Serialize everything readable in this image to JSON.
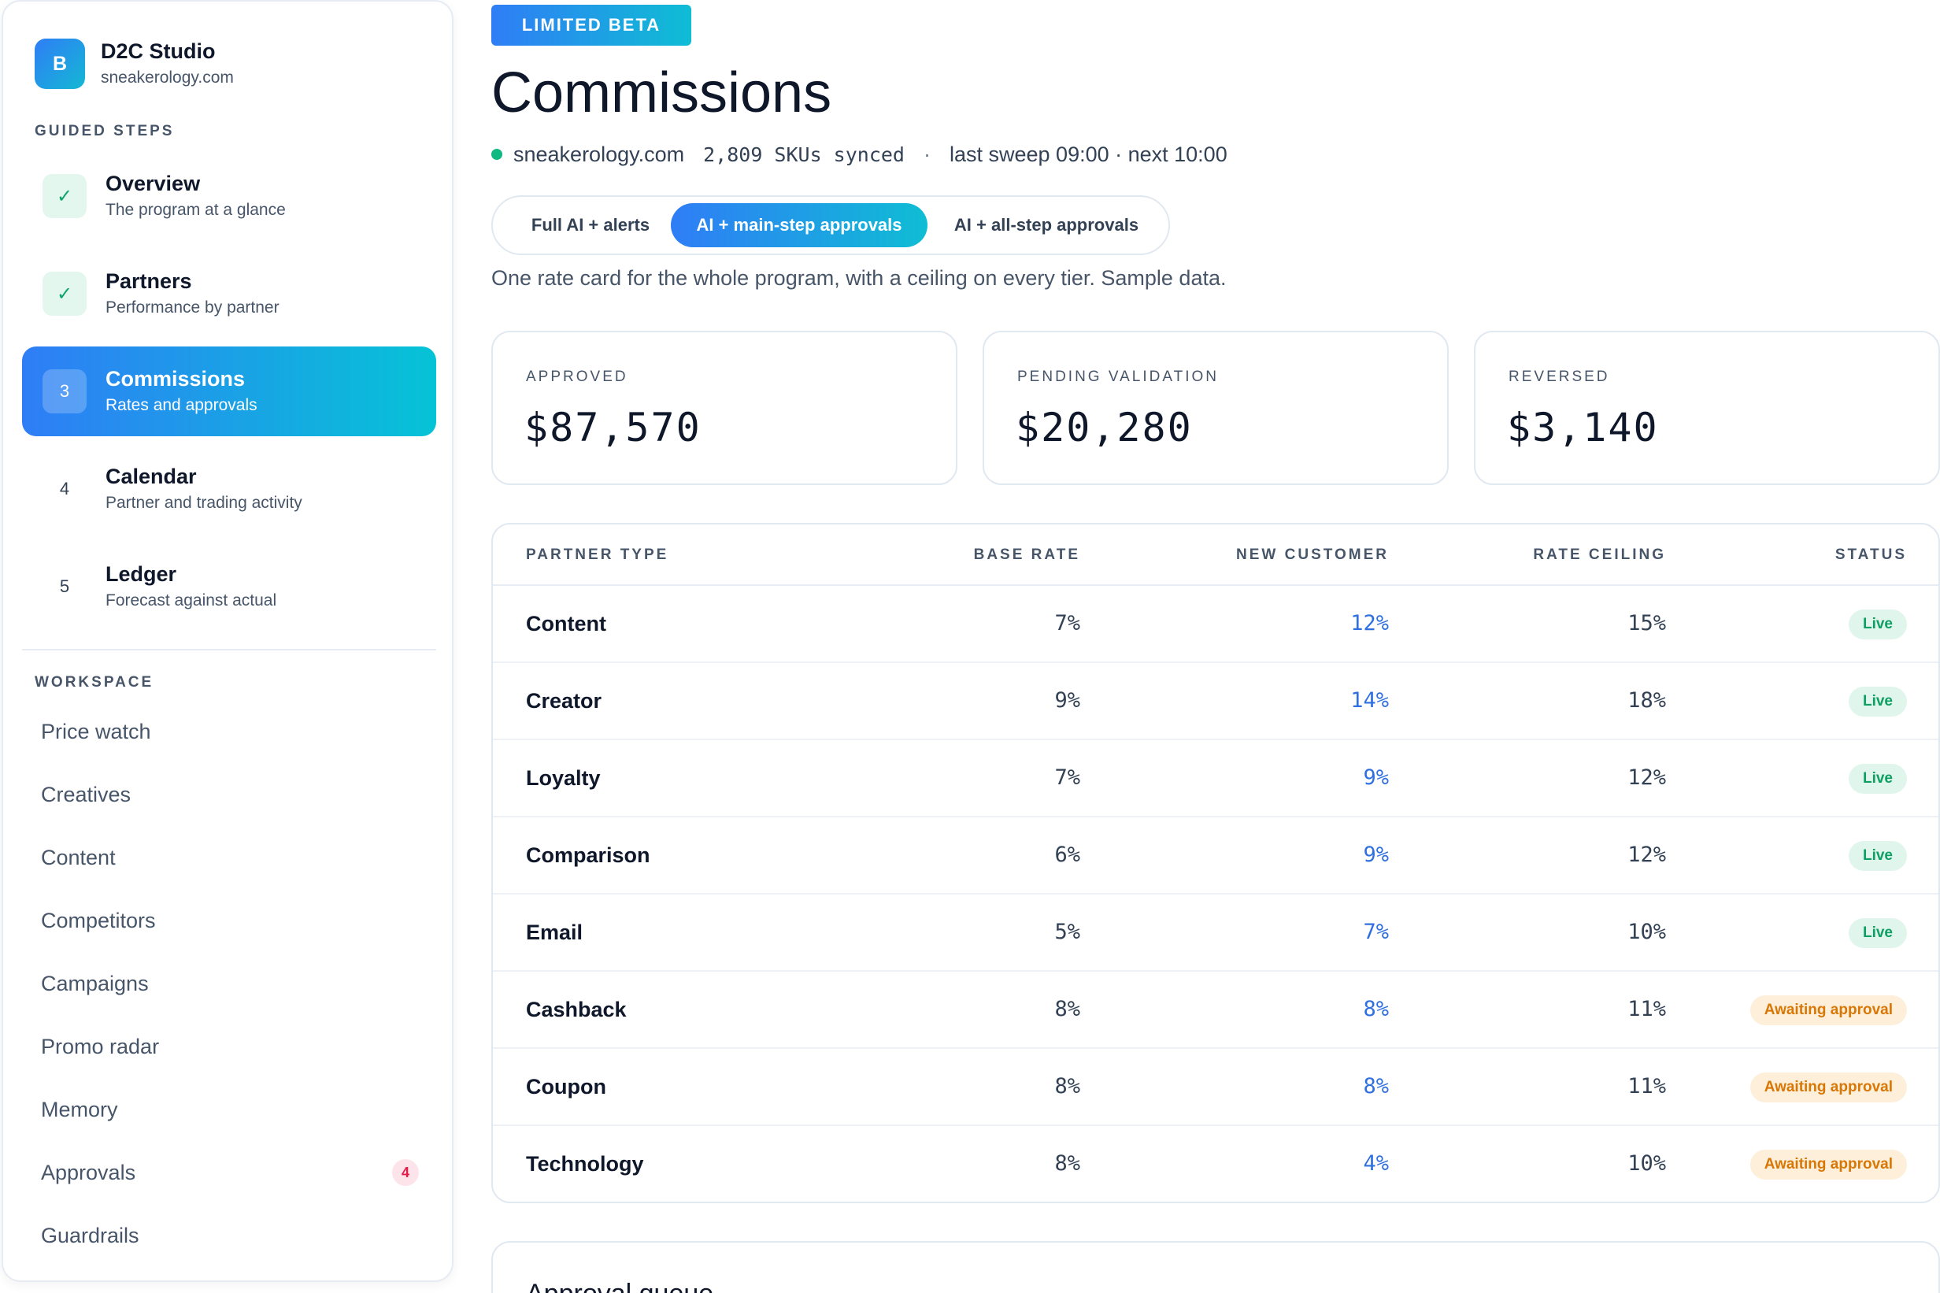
{
  "brand": {
    "logo": "B",
    "name": "D2C Studio",
    "domain": "sneakerology.com"
  },
  "sidebar": {
    "guided_label": "GUIDED STEPS",
    "steps": [
      {
        "marker": "✓",
        "title": "Overview",
        "subtitle": "The program at a glance",
        "state": "done"
      },
      {
        "marker": "✓",
        "title": "Partners",
        "subtitle": "Performance by partner",
        "state": "done"
      },
      {
        "marker": "3",
        "title": "Commissions",
        "subtitle": "Rates and approvals",
        "state": "active"
      },
      {
        "marker": "4",
        "title": "Calendar",
        "subtitle": "Partner and trading activity",
        "state": "todo"
      },
      {
        "marker": "5",
        "title": "Ledger",
        "subtitle": "Forecast against actual",
        "state": "todo"
      }
    ],
    "workspace_label": "WORKSPACE",
    "workspace": [
      {
        "label": "Price watch"
      },
      {
        "label": "Creatives"
      },
      {
        "label": "Content"
      },
      {
        "label": "Competitors"
      },
      {
        "label": "Campaigns"
      },
      {
        "label": "Promo radar"
      },
      {
        "label": "Memory"
      },
      {
        "label": "Approvals",
        "badge": "4"
      },
      {
        "label": "Guardrails"
      }
    ]
  },
  "header": {
    "badge": "LIMITED BETA",
    "title": "Commissions",
    "site": "sneakerology.com",
    "skus": "2,809 SKUs synced",
    "separator": "·",
    "sweep": "last sweep 09:00 · next 10:00"
  },
  "mode_toggle": {
    "options": [
      "Full AI + alerts",
      "AI + main-step approvals",
      "AI + all-step approvals"
    ],
    "selected": "AI + main-step approvals"
  },
  "note": "One rate card for the whole program, with a ceiling on every tier. Sample data.",
  "stats": [
    {
      "label": "APPROVED",
      "value": "$87,570"
    },
    {
      "label": "PENDING VALIDATION",
      "value": "$20,280"
    },
    {
      "label": "REVERSED",
      "value": "$3,140"
    }
  ],
  "table": {
    "headers": {
      "type": "PARTNER TYPE",
      "base": "BASE RATE",
      "new": "NEW CUSTOMER",
      "ceiling": "RATE CEILING",
      "status": "STATUS"
    },
    "rows": [
      {
        "type": "Content",
        "base": "7%",
        "new": "12%",
        "ceiling": "15%",
        "status": "Live"
      },
      {
        "type": "Creator",
        "base": "9%",
        "new": "14%",
        "ceiling": "18%",
        "status": "Live"
      },
      {
        "type": "Loyalty",
        "base": "7%",
        "new": "9%",
        "ceiling": "12%",
        "status": "Live"
      },
      {
        "type": "Comparison",
        "base": "6%",
        "new": "9%",
        "ceiling": "12%",
        "status": "Live"
      },
      {
        "type": "Email",
        "base": "5%",
        "new": "7%",
        "ceiling": "10%",
        "status": "Live"
      },
      {
        "type": "Cashback",
        "base": "8%",
        "new": "8%",
        "ceiling": "11%",
        "status": "Awaiting approval"
      },
      {
        "type": "Coupon",
        "base": "8%",
        "new": "8%",
        "ceiling": "11%",
        "status": "Awaiting approval"
      },
      {
        "type": "Technology",
        "base": "8%",
        "new": "4%",
        "ceiling": "10%",
        "status": "Awaiting approval"
      }
    ]
  },
  "queue": {
    "title": "Approval queue"
  },
  "colors": {
    "accent_start": "#2f7df6",
    "accent_end": "#0fbdd4",
    "live": "#0e9f63",
    "awaiting": "#d97706",
    "badge": "#e11d48"
  }
}
